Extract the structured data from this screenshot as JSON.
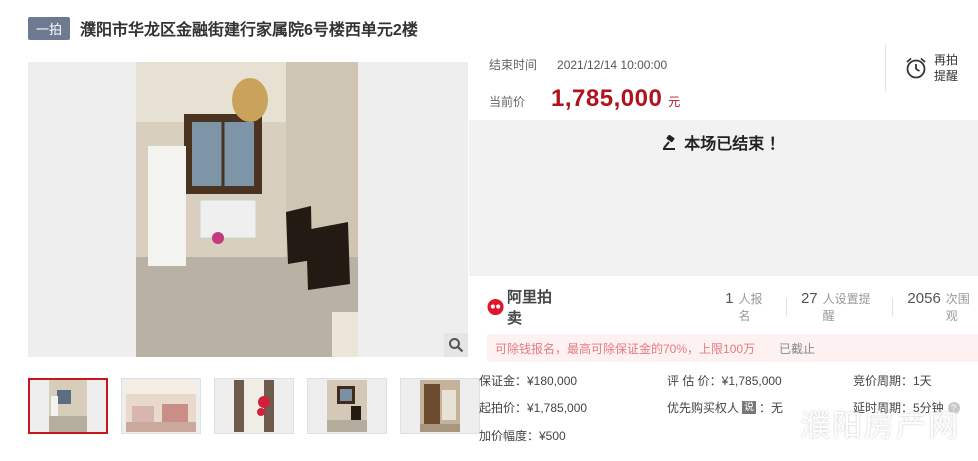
{
  "header": {
    "tag": "一拍",
    "title": "濮阳市华龙区金融街建行家属院6号楼西单元2楼"
  },
  "auction": {
    "end_time_label": "结束时间",
    "end_time": "2021/12/14 10:00:00",
    "price_label": "当前价",
    "price": "1,785,000",
    "price_unit": "元",
    "remind_line1": "再拍",
    "remind_line2": "提醒",
    "status": "本场已结束 ！"
  },
  "platform": {
    "name": "阿里拍卖",
    "brand_color": "#e0172c"
  },
  "stats": [
    {
      "num": "1",
      "label": "人报名"
    },
    {
      "num": "27",
      "label": "人设置提醒"
    },
    {
      "num": "2056",
      "label": "次围观"
    }
  ],
  "notice": {
    "text": "可除钱报名，最高可除保证金的70%，上限100万",
    "status": "已截止"
  },
  "details": {
    "deposit": "保证金：¥180,000",
    "assessment": "评 估 价：¥1,785,000",
    "cycle": "竞价周期：1天",
    "start_price": "起拍价：¥1,785,000",
    "priority_label": "优先购买权人",
    "priority_badge": "说",
    "priority_value": "：无",
    "delay": "延时周期：5分钟",
    "increment": "加价幅度：¥500"
  },
  "watermark": "濮阳房产网",
  "icons": {
    "zoom": "search-icon",
    "alarm": "alarm-clock-icon",
    "gavel": "gavel-icon",
    "help": "help-icon"
  }
}
